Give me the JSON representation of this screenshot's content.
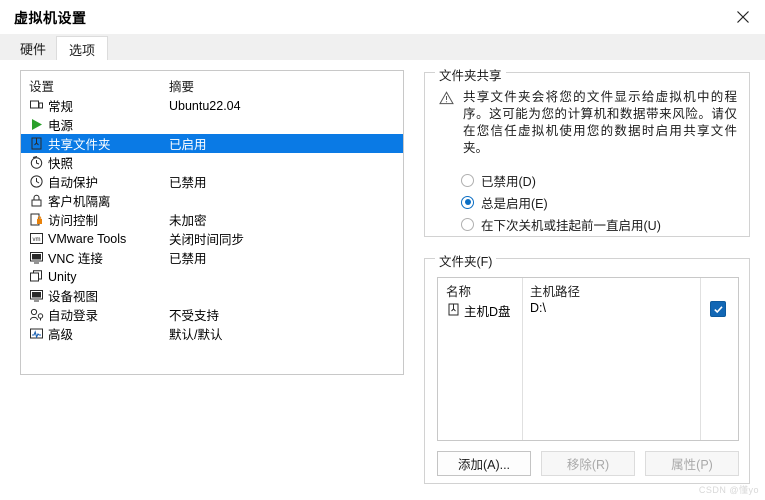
{
  "window": {
    "title": "虚拟机设置",
    "close_label": "✕"
  },
  "tabs": [
    {
      "label": "硬件",
      "active": false
    },
    {
      "label": "选项",
      "active": true
    }
  ],
  "settings_list": {
    "headers": {
      "name": "设置",
      "summary": "摘要"
    },
    "rows": [
      {
        "icon": "monitor-icon",
        "label": "常规",
        "summary": "Ubuntu22.04",
        "selected": false
      },
      {
        "icon": "power-play-icon",
        "label": "电源",
        "summary": "",
        "selected": false
      },
      {
        "icon": "shared-folder-icon",
        "label": "共享文件夹",
        "summary": "已启用",
        "selected": true
      },
      {
        "icon": "snapshot-clock-icon",
        "label": "快照",
        "summary": "",
        "selected": false
      },
      {
        "icon": "autoprotect-icon",
        "label": "自动保护",
        "summary": "已禁用",
        "selected": false
      },
      {
        "icon": "lock-icon",
        "label": "客户机隔离",
        "summary": "",
        "selected": false
      },
      {
        "icon": "access-control-icon",
        "label": "访问控制",
        "summary": "未加密",
        "selected": false
      },
      {
        "icon": "vmware-tools-icon",
        "label": "VMware Tools",
        "summary": "关闭时间同步",
        "selected": false
      },
      {
        "icon": "vnc-icon",
        "label": "VNC 连接",
        "summary": "已禁用",
        "selected": false
      },
      {
        "icon": "unity-icon",
        "label": "Unity",
        "summary": "",
        "selected": false
      },
      {
        "icon": "device-view-icon",
        "label": "设备视图",
        "summary": "",
        "selected": false
      },
      {
        "icon": "auto-login-icon",
        "label": "自动登录",
        "summary": "不受支持",
        "selected": false
      },
      {
        "icon": "advanced-icon",
        "label": "高级",
        "summary": "默认/默认",
        "selected": false
      }
    ]
  },
  "folder_sharing": {
    "title": "文件夹共享",
    "warning_icon": "warning-triangle-icon",
    "warning_text": "共享文件夹会将您的文件显示给虚拟机中的程序。这可能为您的计算机和数据带来风险。请仅在您信任虚拟机使用您的数据时启用共享文件夹。",
    "options": [
      {
        "label": "已禁用(D)",
        "checked": false
      },
      {
        "label": "总是启用(E)",
        "checked": true
      },
      {
        "label": "在下次关机或挂起前一直启用(U)",
        "checked": false
      }
    ]
  },
  "folders": {
    "title": "文件夹(F)",
    "columns": {
      "name": "名称",
      "host_path": "主机路径"
    },
    "rows": [
      {
        "icon": "folder-icon",
        "name": "主机D盘",
        "host_path": "D:\\",
        "enabled": true
      }
    ],
    "buttons": [
      {
        "label": "添加(A)...",
        "disabled": false
      },
      {
        "label": "移除(R)",
        "disabled": true
      },
      {
        "label": "属性(P)",
        "disabled": true
      }
    ]
  },
  "watermark": {
    "text": "CSDN @懂yo"
  },
  "colors": {
    "selection_blue": "#0a7ae5",
    "accent_blue": "#0b6ec4",
    "checkbox_blue": "#1267b5"
  }
}
